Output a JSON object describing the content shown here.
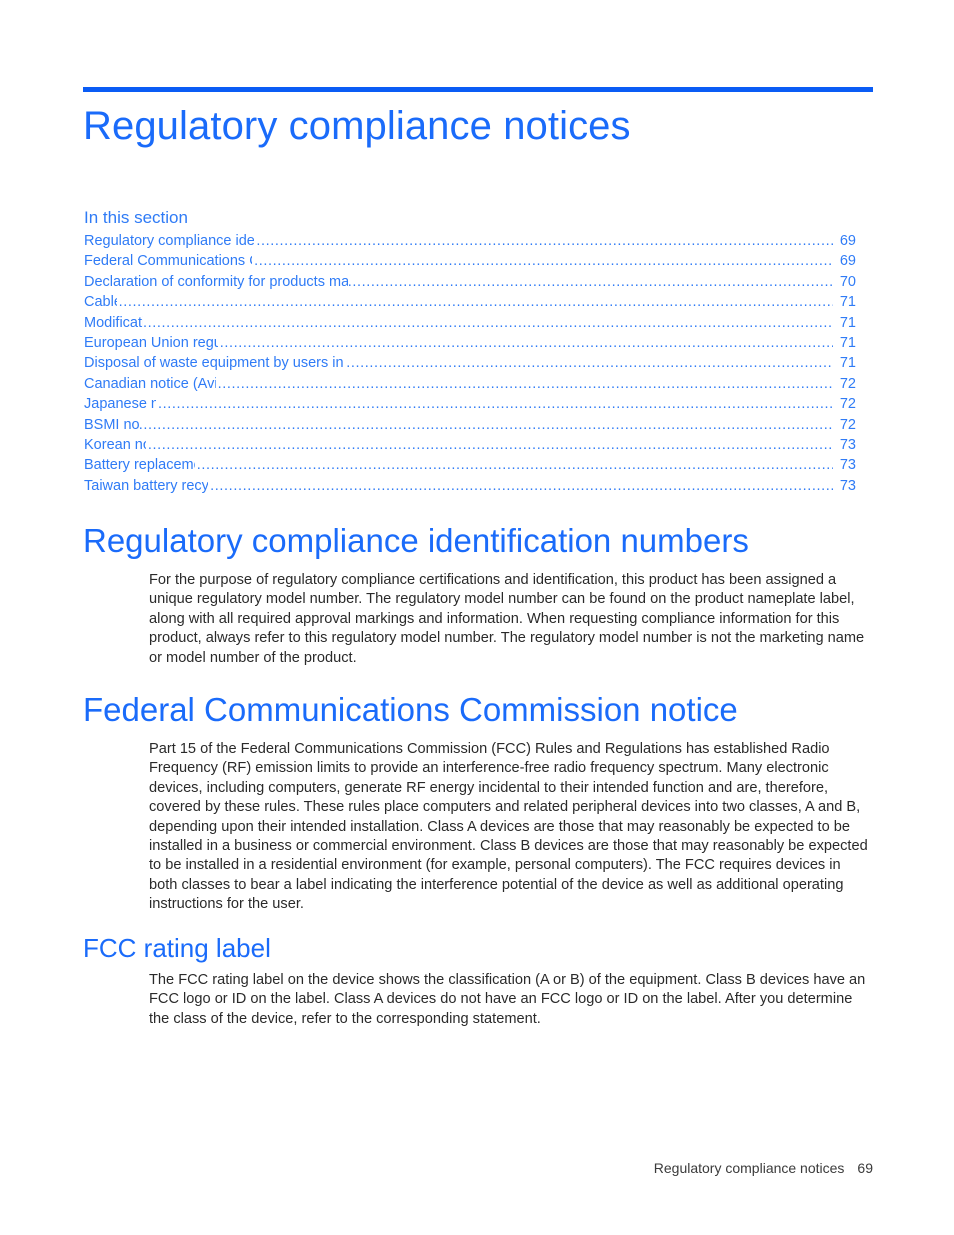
{
  "document": {
    "title": "Regulatory compliance notices",
    "accent_color": "#1a6bfa",
    "rule_color": "#0a5cf5",
    "body_color": "#2a2a2a"
  },
  "toc": {
    "heading": "In this section",
    "entries": [
      {
        "label": "Regulatory compliance identification numbers",
        "page": "69"
      },
      {
        "label": "Federal Communications Commission notice",
        "page": "69"
      },
      {
        "label": "Declaration of conformity for products marked with the FCC logo, United States only",
        "page": "70"
      },
      {
        "label": "Cables",
        "page": "71"
      },
      {
        "label": "Modifications",
        "page": "71"
      },
      {
        "label": "European Union regulatory notice",
        "page": "71"
      },
      {
        "label": "Disposal of waste equipment by users in private households in the European Union",
        "page": "71"
      },
      {
        "label": "Canadian notice (Avis Canadien)",
        "page": "72"
      },
      {
        "label": "Japanese notice",
        "page": "72"
      },
      {
        "label": "BSMI notice",
        "page": "72"
      },
      {
        "label": "Korean notice",
        "page": "73"
      },
      {
        "label": "Battery replacement notice",
        "page": "73"
      },
      {
        "label": "Taiwan battery recycling notice",
        "page": "73"
      }
    ]
  },
  "sections": {
    "rcin": {
      "heading": "Regulatory compliance identification numbers",
      "paragraph": "For the purpose of regulatory compliance certifications and identification, this product has been assigned a unique regulatory model number. The regulatory model number can be found on the product nameplate label, along with all required approval markings and information. When requesting compliance information for this product, always refer to this regulatory model number. The regulatory model number is not the marketing name or model number of the product."
    },
    "fcc_notice": {
      "heading": "Federal Communications Commission notice",
      "paragraph": "Part 15 of the Federal Communications Commission (FCC) Rules and Regulations has established Radio Frequency (RF) emission limits to provide an interference-free radio frequency spectrum. Many electronic devices, including computers, generate RF energy incidental to their intended function and are, therefore, covered by these rules. These rules place computers and related peripheral devices into two classes, A and B, depending upon their intended installation. Class A devices are those that may reasonably be expected to be installed in a business or commercial environment. Class B devices are those that may reasonably be expected to be installed in a residential environment (for example, personal computers). The FCC requires devices in both classes to bear a label indicating the interference potential of the device as well as additional operating instructions for the user."
    },
    "fcc_rating_label": {
      "heading": "FCC rating label",
      "paragraph": "The FCC rating label on the device shows the classification (A or B) of the equipment. Class B devices have an FCC logo or ID on the label. Class A devices do not have an FCC logo or ID on the label. After you determine the class of the device, refer to the corresponding statement."
    }
  },
  "footer": {
    "label": "Regulatory compliance notices",
    "page": "69"
  }
}
